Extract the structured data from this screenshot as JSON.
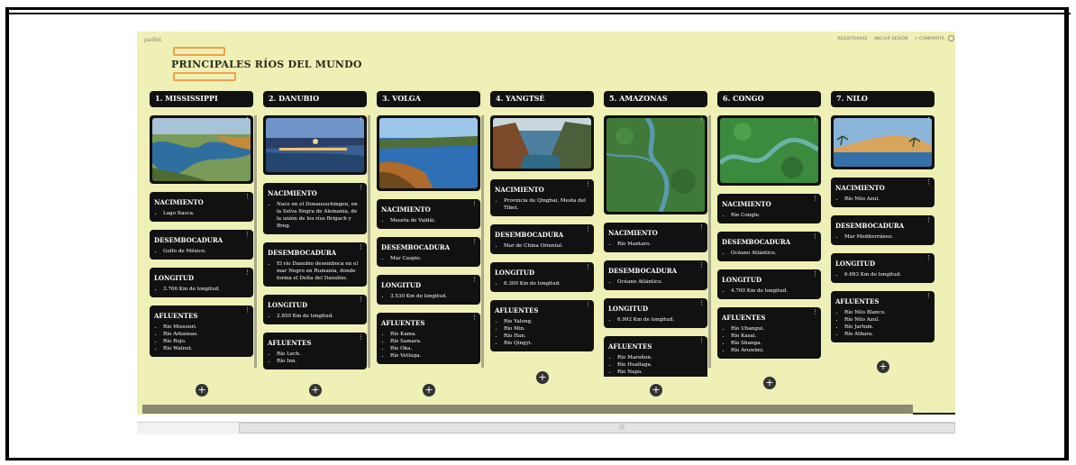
{
  "app": {
    "name": "padlet"
  },
  "nav": {
    "register": "REGISTRARSE",
    "login": "INICIAR SESIÓN",
    "share": "COMPARTIR"
  },
  "title": "PRINCIPALES RÍOS DEL MUNDO",
  "columns": [
    {
      "header": "1. MISSISSIPPI",
      "cards": [
        {
          "title": "NACIMIENTO",
          "items": [
            "Lago Itasca."
          ]
        },
        {
          "title": "DESEMBOCADURA",
          "items": [
            "Golfo de México."
          ]
        },
        {
          "title": "LONGITUD",
          "items": [
            "3.766 Km de longitud."
          ]
        },
        {
          "title": "AFLUENTES",
          "items": [
            "Río Missouri.",
            "Río Arkansas.",
            "Río Rojo.",
            "Río Walnut."
          ]
        }
      ]
    },
    {
      "header": "2. DANUBIO",
      "cards": [
        {
          "title": "NACIMIENTO",
          "items": [
            "Nace en el Donaueschingen, en la Selva Negra de Alemania, de la unión de los ríos Brigach y Breg."
          ]
        },
        {
          "title": "DESEMBOCADURA",
          "items": [
            "El río Danubio desemboca en el mar Negro en Rumanía, donde forma el Delta del Danubio."
          ]
        },
        {
          "title": "LONGITUD",
          "items": [
            "2.850 Km de longitud."
          ]
        },
        {
          "title": "AFLUENTES",
          "items": [
            "Río Lech.",
            "Río Inn."
          ]
        }
      ]
    },
    {
      "header": "3. VOLGA",
      "cards": [
        {
          "title": "NACIMIENTO",
          "items": [
            "Meseta de Valdái."
          ]
        },
        {
          "title": "DESEMBOCADURA",
          "items": [
            "Mar Caspio."
          ]
        },
        {
          "title": "LONGITUD",
          "items": [
            "3.530 Km de longitud."
          ]
        },
        {
          "title": "AFLUENTES",
          "items": [
            "Río Kama.",
            "Río Samara.",
            "Río Oka.",
            "Río Vetluga."
          ]
        }
      ]
    },
    {
      "header": "4. YANGTSÉ",
      "cards": [
        {
          "title": "NACIMIENTO",
          "items": [
            "Provincia de Qinghai, Mesta del Tibet."
          ]
        },
        {
          "title": "DESEMBOCADURA",
          "items": [
            "Mar de China Oriental."
          ]
        },
        {
          "title": "LONGITUD",
          "items": [
            "6.300 Km de longitud."
          ]
        },
        {
          "title": "AFLUENTES",
          "items": [
            "Río Yalong.",
            "Río Min.",
            "Río Han.",
            "Río Qingyi."
          ]
        }
      ]
    },
    {
      "header": "5. AMAZONAS",
      "cards": [
        {
          "title": "NACIMIENTO",
          "items": [
            "Río Mantaro."
          ]
        },
        {
          "title": "DESEMBOCADURA",
          "items": [
            "Océano Atlántico."
          ]
        },
        {
          "title": "LONGITUD",
          "items": [
            "6.992 Km de longitud."
          ]
        },
        {
          "title": "AFLUENTES",
          "items": [
            "Río Marañon.",
            "Río Huallaga.",
            "Río Napo."
          ]
        }
      ]
    },
    {
      "header": "6. CONGO",
      "cards": [
        {
          "title": "NACIMIENTO",
          "items": [
            "Río Congle."
          ]
        },
        {
          "title": "DESEMBOCADURA",
          "items": [
            "Océano Atlántico."
          ]
        },
        {
          "title": "LONGITUD",
          "items": [
            "4.700 Km de longitud."
          ]
        },
        {
          "title": "AFLUENTES",
          "items": [
            "Río Ubangui.",
            "Río Kasai.",
            "Río Shanga.",
            "Río Aruwimi."
          ]
        }
      ]
    },
    {
      "header": "7. NILO",
      "cards": [
        {
          "title": "NACIMIENTO",
          "items": [
            "Río Nilo Azul."
          ]
        },
        {
          "title": "DESEMBOCADURA",
          "items": [
            "Mar Mediterráneo."
          ]
        },
        {
          "title": "LONGITUD",
          "items": [
            "6.693 Km de longitud."
          ]
        },
        {
          "title": "AFLUENTES",
          "items": [
            "Río Nilo Blanco.",
            "Río Nilo Azul.",
            "Río Jartum.",
            "Río Atbara."
          ]
        }
      ]
    }
  ],
  "ui": {
    "add_symbol": "+",
    "menu_symbol": "⋮",
    "scroll_grip": "|||"
  },
  "colors": {
    "board_bg": "#eef0b5",
    "card_bg": "#111111",
    "accent": "#f0a04b"
  }
}
